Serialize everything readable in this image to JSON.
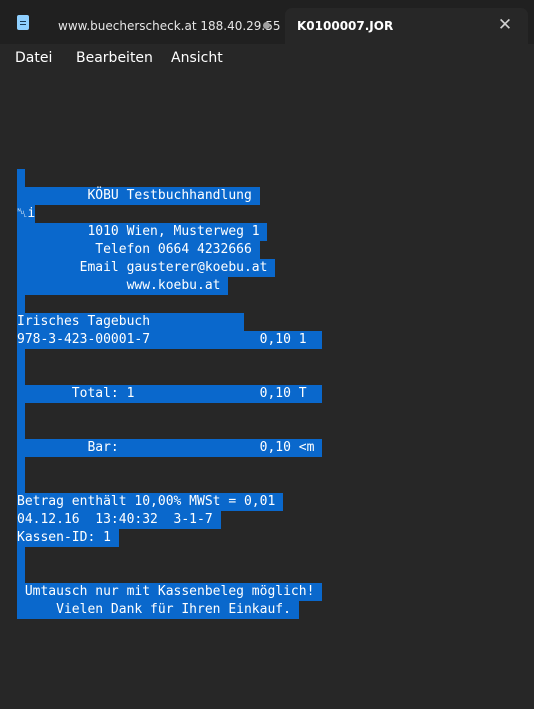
{
  "tabs": [
    {
      "label": "www.buecherscheck.at 188.40.29.55",
      "active": false,
      "unsaved": true
    },
    {
      "label": "K0100007.JOR",
      "active": true
    }
  ],
  "menu": [
    "Datei",
    "Bearbeiten",
    "Ansicht"
  ],
  "document": {
    "lines": [
      " ",
      "         KÖBU Testbuchhandlung ",
      "␀i",
      "         1010 Wien, Musterweg 1 ",
      "          Telefon 0664 4232666 ",
      "        Email gausterer@koebu.at ",
      "              www.koebu.at ",
      " ",
      "Irisches Tagebuch            ",
      "978-3-423-00001-7              0,10 1  ",
      " ",
      " ",
      "       Total: 1                0,10 T  ",
      " ",
      " ",
      "         Bar:                  0,10 <m ",
      " ",
      " ",
      "Betrag enthält 10,00% MWSt = 0,01 ",
      "04.12.16  13:40:32  3-1-7 ",
      "Kassen-ID: 1 ",
      " ",
      " ",
      " Umtausch nur mit Kassenbeleg möglich! ",
      "     Vielen Dank für Ihren Einkauf. "
    ]
  },
  "colors": {
    "background": "#272727",
    "titlebar": "#202020",
    "selection": "#0a68cc",
    "text": "#ffffff"
  }
}
